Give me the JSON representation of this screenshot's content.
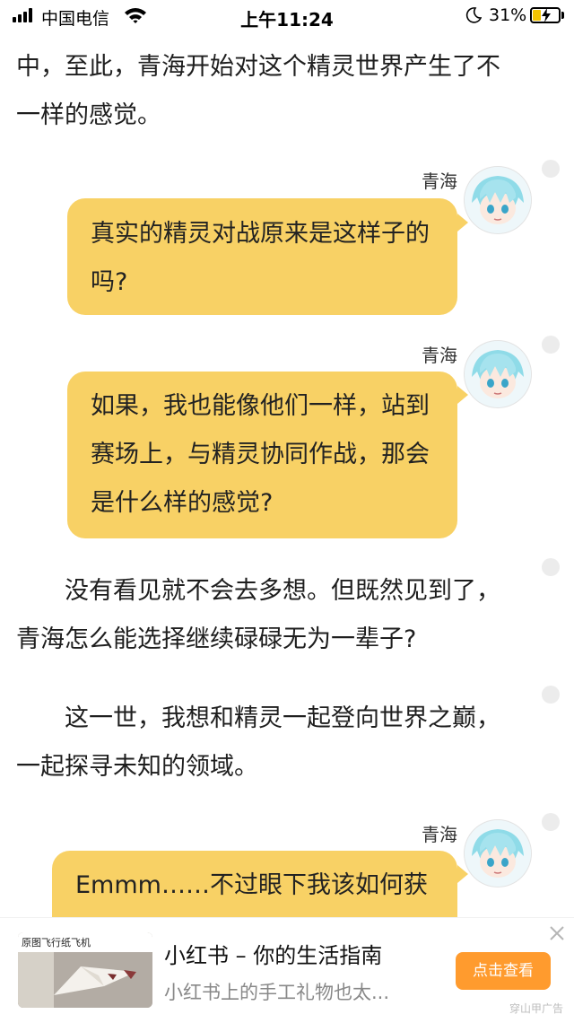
{
  "status_bar": {
    "carrier": "中国电信",
    "time": "上午11:24",
    "battery_percent": "31%",
    "battery_level": 0.31,
    "icons": [
      "signal-icon",
      "wifi-icon",
      "moon-icon",
      "battery-charging-icon"
    ]
  },
  "content": {
    "p1": "中，至此，青海开始对这个精灵世界产生了不一样的感觉。",
    "dialogues": [
      {
        "speaker": "青海",
        "text": "真实的精灵对战原来是这样子的吗?"
      },
      {
        "speaker": "青海",
        "text": "如果，我也能像他们一样，站到赛场上，与精灵协同作战，那会是什么样的感觉?"
      }
    ],
    "p2": "没有看见就不会去多想。但既然见到了，青海怎么能选择继续碌碌无为一辈子?",
    "p3": "这一世，我想和精灵一起登向世界之巅，一起探寻未知的领域。",
    "dialogue3": {
      "speaker": "青海",
      "text": "Emmm……不过眼下我该如何获"
    }
  },
  "ad": {
    "thumb_text": "原图飞行纸飞机",
    "title": "小红书 – 你的生活指南",
    "description": "小红书上的手工礼物也太...",
    "button": "点击查看",
    "source": "穿山甲广告",
    "close_icon": "close-icon",
    "bubble_color": "#f8d165",
    "button_color": "#ff9b2e"
  }
}
